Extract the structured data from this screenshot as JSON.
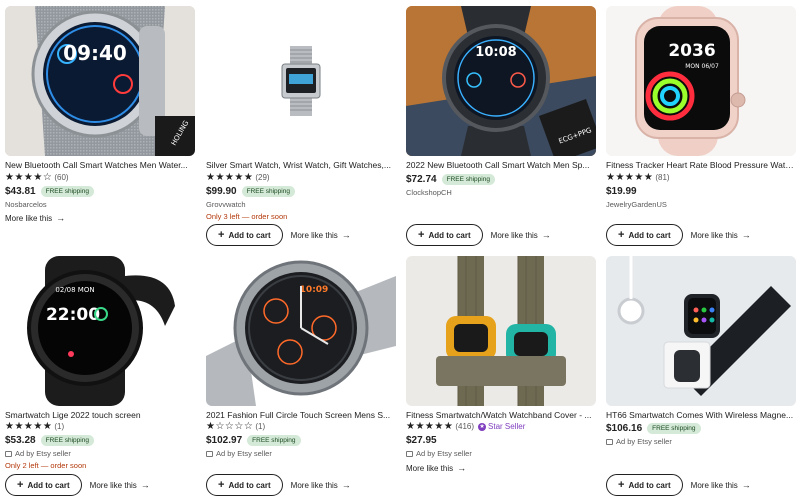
{
  "labels": {
    "add_to_cart": "Add to cart",
    "more_like_this": "More like this",
    "free_shipping": "FREE shipping",
    "ad_by": "Ad by Etsy seller",
    "star_seller": "Star Seller"
  },
  "icons": {
    "star": "star-icon",
    "arrow": "arrow-right-icon",
    "plus": "plus-icon",
    "ad": "ad-icon",
    "star_seller": "star-seller-badge-icon"
  },
  "colors": {
    "shipping_badge_bg": "#d4e9d7",
    "stock_warning": "#b3380b",
    "star_seller": "#7f3dbf"
  },
  "products": [
    {
      "title": "New Bluetooth Call Smart Watches Men Water...",
      "rating": 4.5,
      "stars": "★★★★☆",
      "reviews": "(60)",
      "price": "$43.81",
      "free_shipping": true,
      "seller": "Nosbarcelos",
      "stock": "",
      "ad": false
    },
    {
      "title": "Silver Smart Watch, Wrist Watch, Gift Watches,...",
      "rating": 5,
      "stars": "★★★★★",
      "reviews": "(29)",
      "price": "$99.90",
      "free_shipping": true,
      "seller": "Grovvwatch",
      "stock": "Only 3 left — order soon",
      "ad": false
    },
    {
      "title": "2022 New Bluetooth Call Smart Watch Men Sp...",
      "rating": null,
      "stars": "",
      "reviews": "",
      "price": "$72.74",
      "free_shipping": true,
      "seller": "ClockshopCH",
      "stock": "",
      "ad": false
    },
    {
      "title": "Fitness Tracker Heart Rate Blood Pressure Wate...",
      "rating": 5,
      "stars": "★★★★★",
      "reviews": "(81)",
      "price": "$19.99",
      "free_shipping": false,
      "seller": "JewelryGardenUS",
      "stock": "",
      "ad": false
    },
    {
      "title": "Smartwatch Lige 2022 touch screen",
      "rating": 5,
      "stars": "★★★★★",
      "reviews": "(1)",
      "price": "$53.28",
      "free_shipping": true,
      "seller": "",
      "stock": "Only 2 left — order soon",
      "ad": true
    },
    {
      "title": "2021 Fashion Full Circle Touch Screen Mens S...",
      "rating": 1,
      "stars": "★☆☆☆☆",
      "reviews": "(1)",
      "price": "$102.97",
      "free_shipping": true,
      "seller": "",
      "stock": "",
      "ad": true
    },
    {
      "title": "Fitness Smartwatch/Watch Watchband Cover - ...",
      "rating": 5,
      "stars": "★★★★★",
      "reviews": "(416)",
      "price": "$27.95",
      "free_shipping": false,
      "seller": "",
      "stock": "",
      "ad": true,
      "star_seller": true
    },
    {
      "title": "HT66 Smartwatch Comes With Wireless Magne...",
      "rating": null,
      "stars": "",
      "reviews": "",
      "price": "$106.16",
      "free_shipping": true,
      "seller": "",
      "stock": "",
      "ad": true
    }
  ],
  "thumbnails": [
    {
      "clock_text": "09:40"
    },
    {
      "clock_text": ""
    },
    {
      "clock_text": "10:08",
      "badge_text": "ECG+PPG"
    },
    {
      "clock_text": "2036",
      "date_text": "MON 06/07"
    },
    {
      "clock_text": "22:00",
      "date_text": "02/08 MON"
    },
    {
      "clock_text": "10:09"
    },
    {
      "clock_text": ""
    },
    {
      "clock_text": ""
    }
  ]
}
